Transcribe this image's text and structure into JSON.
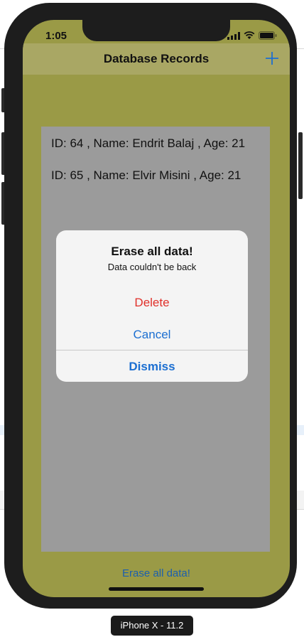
{
  "status_bar": {
    "time": "1:05"
  },
  "navbar": {
    "title": "Database Records",
    "add_label": "+"
  },
  "records": [
    "ID: 64 , Name: Endrit Balaj , Age: 21",
    "ID: 65 , Name: Elvir Misini , Age: 21"
  ],
  "alert": {
    "title": "Erase all data!",
    "message": "Data couldn't be back",
    "delete_label": "Delete",
    "cancel_label": "Cancel",
    "dismiss_label": "Dismiss"
  },
  "footer": {
    "erase_label": "Erase all data!"
  },
  "simulator": {
    "device_label": "iPhone X - 11.2"
  },
  "colors": {
    "app_background": "#9a9a46",
    "destructive": "#e0302a",
    "tint": "#1c6fd1"
  },
  "icons": {
    "add": "plus-icon",
    "signal": "signal-icon",
    "wifi": "wifi-icon",
    "battery": "battery-icon"
  }
}
